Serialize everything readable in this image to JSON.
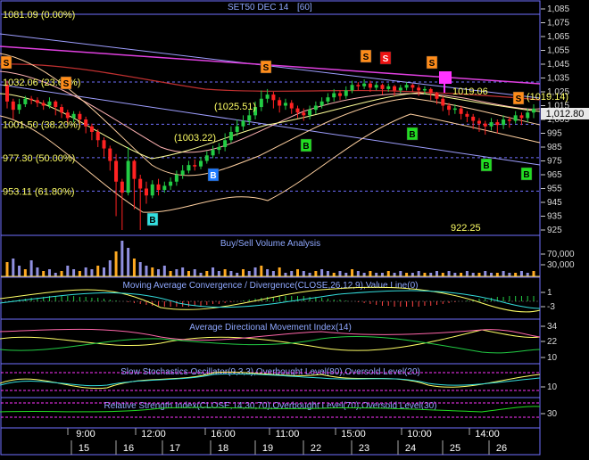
{
  "chart_data": {
    "type": "candlestick",
    "title": "SET50 DEC 14",
    "period": "[60]",
    "y_axis": {
      "min": 925,
      "max": 1085,
      "ticks": [
        1085,
        1075,
        1065,
        1055,
        1045,
        1035,
        1025,
        1015,
        1005,
        995,
        985,
        975,
        965,
        955,
        945,
        935,
        925
      ]
    },
    "last_price": "1,012.80",
    "price_labels": [
      {
        "text": "1081.09 (0.00%)",
        "value": 1081.09
      },
      {
        "text": "1032.06 (23.60%)",
        "value": 1032.06
      },
      {
        "text": "1001.50 (38.20%)",
        "value": 1001.5
      },
      {
        "text": "977.30 (50.00%)",
        "value": 977.3
      },
      {
        "text": "953.11 (61.80%)",
        "value": 953.11
      }
    ],
    "annotations": [
      "(1025.51)",
      "(1003.22)",
      "1019.06",
      "(1019.14)",
      "922.25"
    ],
    "signals": [
      "S",
      "S",
      "S",
      "S",
      "S",
      "S",
      "S",
      "B",
      "B",
      "B",
      "B",
      "B",
      "B"
    ],
    "x_tick_labels": {
      "times": [
        "9:00",
        "12:00",
        "16:00",
        "11:00",
        "15:00",
        "10:00",
        "14:00"
      ],
      "days": [
        "15",
        "16",
        "17",
        "18",
        "19",
        "22",
        "23",
        "24",
        "25",
        "26"
      ]
    },
    "ohlc": [
      {
        "o": 1030,
        "h": 1033,
        "l": 1013,
        "c": 1018
      },
      {
        "o": 1018,
        "c": 1012,
        "h": 1020,
        "l": 1005
      },
      {
        "o": 1012,
        "c": 1016,
        "h": 1020,
        "l": 1009
      },
      {
        "o": 1016,
        "c": 1020,
        "h": 1022,
        "l": 1014
      },
      {
        "o": 1020,
        "c": 1019,
        "h": 1022,
        "l": 1016
      },
      {
        "o": 1019,
        "c": 1017,
        "h": 1021,
        "l": 1014
      },
      {
        "o": 1017,
        "c": 1015,
        "h": 1019,
        "l": 1012
      },
      {
        "o": 1015,
        "c": 1018,
        "h": 1021,
        "l": 1013
      },
      {
        "o": 1018,
        "c": 1014,
        "h": 1019,
        "l": 1008
      },
      {
        "o": 1014,
        "c": 1010,
        "h": 1016,
        "l": 1006
      },
      {
        "o": 1010,
        "c": 1006,
        "h": 1012,
        "l": 1001
      },
      {
        "o": 1006,
        "c": 1009,
        "h": 1011,
        "l": 1003
      },
      {
        "o": 1009,
        "c": 1005,
        "h": 1011,
        "l": 999
      },
      {
        "o": 1005,
        "c": 1000,
        "h": 1007,
        "l": 995
      },
      {
        "o": 1000,
        "c": 996,
        "h": 1002,
        "l": 990
      },
      {
        "o": 996,
        "c": 990,
        "h": 998,
        "l": 985
      },
      {
        "o": 990,
        "c": 984,
        "h": 992,
        "l": 978
      },
      {
        "o": 984,
        "c": 975,
        "h": 986,
        "l": 968
      },
      {
        "o": 975,
        "c": 960,
        "h": 980,
        "l": 935
      },
      {
        "o": 960,
        "c": 952,
        "h": 962,
        "l": 925
      },
      {
        "o": 952,
        "c": 975,
        "h": 985,
        "l": 950
      },
      {
        "o": 975,
        "c": 962,
        "h": 976,
        "l": 940
      },
      {
        "o": 962,
        "c": 955,
        "h": 965,
        "l": 925
      },
      {
        "o": 955,
        "c": 950,
        "h": 960,
        "l": 944
      },
      {
        "o": 950,
        "c": 958,
        "h": 961,
        "l": 948
      },
      {
        "o": 958,
        "c": 954,
        "h": 962,
        "l": 950
      },
      {
        "o": 954,
        "c": 957,
        "h": 960,
        "l": 952
      },
      {
        "o": 957,
        "c": 960,
        "h": 963,
        "l": 954
      },
      {
        "o": 960,
        "c": 965,
        "h": 968,
        "l": 957
      },
      {
        "o": 965,
        "c": 968,
        "h": 972,
        "l": 962
      },
      {
        "o": 968,
        "c": 972,
        "h": 975,
        "l": 966
      },
      {
        "o": 972,
        "c": 971,
        "h": 976,
        "l": 968
      },
      {
        "o": 971,
        "c": 975,
        "h": 978,
        "l": 969
      },
      {
        "o": 975,
        "c": 979,
        "h": 982,
        "l": 973
      },
      {
        "o": 979,
        "c": 983,
        "h": 986,
        "l": 977
      },
      {
        "o": 983,
        "c": 985,
        "h": 988,
        "l": 980
      },
      {
        "o": 985,
        "c": 990,
        "h": 995,
        "l": 982
      },
      {
        "o": 990,
        "c": 996,
        "h": 1000,
        "l": 988
      },
      {
        "o": 996,
        "c": 1000,
        "h": 1005,
        "l": 993
      },
      {
        "o": 1000,
        "c": 1004,
        "h": 1008,
        "l": 997
      },
      {
        "o": 1004,
        "c": 1008,
        "h": 1012,
        "l": 1001
      },
      {
        "o": 1008,
        "c": 1014,
        "h": 1018,
        "l": 1005
      },
      {
        "o": 1014,
        "c": 1020,
        "h": 1026,
        "l": 1011
      },
      {
        "o": 1020,
        "c": 1023,
        "h": 1027,
        "l": 1017
      },
      {
        "o": 1023,
        "c": 1019,
        "h": 1025,
        "l": 1013
      },
      {
        "o": 1019,
        "c": 1015,
        "h": 1021,
        "l": 1010
      },
      {
        "o": 1015,
        "c": 1017,
        "h": 1020,
        "l": 1012
      },
      {
        "o": 1017,
        "c": 1013,
        "h": 1019,
        "l": 1009
      },
      {
        "o": 1013,
        "c": 1010,
        "h": 1015,
        "l": 1006
      },
      {
        "o": 1010,
        "c": 1008,
        "h": 1013,
        "l": 1004
      },
      {
        "o": 1008,
        "c": 1012,
        "h": 1015,
        "l": 1005
      },
      {
        "o": 1012,
        "c": 1015,
        "h": 1018,
        "l": 1009
      },
      {
        "o": 1015,
        "c": 1018,
        "h": 1021,
        "l": 1013
      },
      {
        "o": 1018,
        "c": 1021,
        "h": 1024,
        "l": 1016
      },
      {
        "o": 1021,
        "c": 1024,
        "h": 1027,
        "l": 1018
      },
      {
        "o": 1024,
        "c": 1022,
        "h": 1026,
        "l": 1019
      },
      {
        "o": 1022,
        "c": 1026,
        "h": 1029,
        "l": 1020
      },
      {
        "o": 1026,
        "c": 1030,
        "h": 1033,
        "l": 1024
      },
      {
        "o": 1030,
        "c": 1029,
        "h": 1032,
        "l": 1026
      },
      {
        "o": 1029,
        "c": 1031,
        "h": 1034,
        "l": 1027
      },
      {
        "o": 1031,
        "c": 1028,
        "h": 1033,
        "l": 1025
      },
      {
        "o": 1028,
        "c": 1030,
        "h": 1032,
        "l": 1026
      },
      {
        "o": 1030,
        "c": 1027,
        "h": 1031,
        "l": 1023
      },
      {
        "o": 1027,
        "c": 1029,
        "h": 1031,
        "l": 1025
      },
      {
        "o": 1029,
        "c": 1026,
        "h": 1030,
        "l": 1022
      },
      {
        "o": 1026,
        "c": 1028,
        "h": 1030,
        "l": 1024
      },
      {
        "o": 1028,
        "c": 1030,
        "h": 1032,
        "l": 1026
      },
      {
        "o": 1030,
        "c": 1028,
        "h": 1031,
        "l": 1025
      },
      {
        "o": 1028,
        "c": 1026,
        "h": 1030,
        "l": 1022
      },
      {
        "o": 1026,
        "c": 1027,
        "h": 1029,
        "l": 1023
      },
      {
        "o": 1027,
        "c": 1024,
        "h": 1028,
        "l": 1019
      },
      {
        "o": 1024,
        "c": 1020,
        "h": 1025,
        "l": 1016
      },
      {
        "o": 1020,
        "c": 1015,
        "h": 1022,
        "l": 1011
      },
      {
        "o": 1015,
        "c": 1012,
        "h": 1017,
        "l": 1008
      },
      {
        "o": 1012,
        "c": 1013,
        "h": 1016,
        "l": 1009
      },
      {
        "o": 1013,
        "c": 1009,
        "h": 1015,
        "l": 1005
      },
      {
        "o": 1009,
        "c": 1007,
        "h": 1011,
        "l": 1003
      },
      {
        "o": 1007,
        "c": 1004,
        "h": 1009,
        "l": 998
      },
      {
        "o": 1004,
        "c": 1002,
        "h": 1006,
        "l": 996
      },
      {
        "o": 1002,
        "c": 1000,
        "h": 1004,
        "l": 994
      },
      {
        "o": 1000,
        "c": 1003,
        "h": 1006,
        "l": 997
      },
      {
        "o": 1003,
        "c": 1001,
        "h": 1005,
        "l": 995
      },
      {
        "o": 1001,
        "c": 1005,
        "h": 1008,
        "l": 998
      },
      {
        "o": 1005,
        "c": 1004,
        "h": 1007,
        "l": 999
      },
      {
        "o": 1004,
        "c": 1008,
        "h": 1011,
        "l": 1002
      },
      {
        "o": 1008,
        "c": 1006,
        "h": 1010,
        "l": 1001
      },
      {
        "o": 1006,
        "c": 1010,
        "h": 1013,
        "l": 1003
      },
      {
        "o": 1010,
        "c": 1012.8,
        "h": 1016,
        "l": 1006
      }
    ],
    "panels": [
      {
        "title": "Buy/Sell Volume Analysis",
        "y_ticks": [
          "70,000",
          "30,000"
        ]
      },
      {
        "title": "Moving Average Convergence / Divergence(CLOSE,26,12,9),Value Line(0)",
        "y_ticks": [
          "1",
          "-3"
        ]
      },
      {
        "title": "Average Directional Movement Index(14)",
        "y_ticks": [
          "34",
          "22",
          "10"
        ]
      },
      {
        "title": "Slow Stochastics Oscillator(9,3,3),Overbought Level(80),Oversold Level(20)",
        "y_ticks": [
          "10"
        ]
      },
      {
        "title": "Relative Strength Index(CLOSE,14,30,70),Overbought Level(70),Oversold Level(30)",
        "y_ticks": [
          "30"
        ]
      }
    ],
    "colors": {
      "up": "#22cc44",
      "down": "#ff2222",
      "sell_orange": "#ff8c1a",
      "sell_red": "#ee1111",
      "sell_magenta": "#ff33ff",
      "buy_green": "#22dd22",
      "buy_blue": "#1e7bff",
      "buy_cyan": "#33e0e0",
      "fib": "#ffff66",
      "title": "#8fa8ff",
      "grid": "#4a4aa0"
    }
  }
}
